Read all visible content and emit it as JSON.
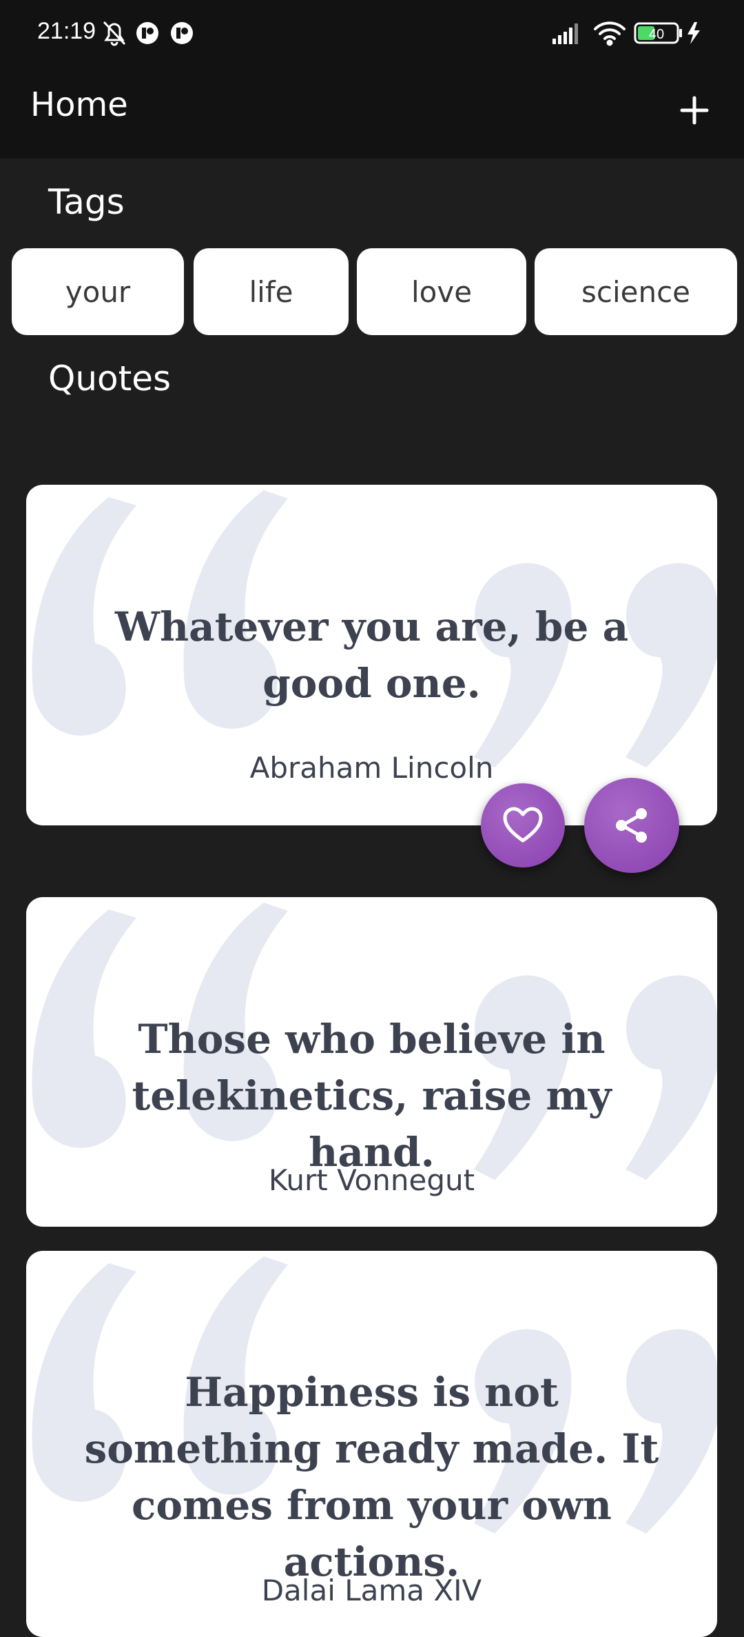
{
  "status": {
    "time": "21:19",
    "battery": "40"
  },
  "app_bar": {
    "title": "Home",
    "add_icon": "plus-icon"
  },
  "tags": {
    "title": "Tags",
    "items": [
      "your",
      "life",
      "love",
      "science"
    ]
  },
  "quotes": {
    "title": "Quotes",
    "items": [
      {
        "text": "Whatever you are, be a good one.",
        "author": "Abraham Lincoln"
      },
      {
        "text": "Those who believe in telekinetics, raise my hand.",
        "author": "Kurt Vonnegut"
      },
      {
        "text": "Happiness is not something ready made. It comes from your own actions.",
        "author": "Dalai Lama XIV"
      }
    ]
  },
  "actions": {
    "like_icon": "heart-icon",
    "share_icon": "share-icon"
  },
  "colors": {
    "background": "#1e1e1f",
    "app_bar": "#121212",
    "card": "#ffffff",
    "quote_text": "#3d4250",
    "quote_mark": "#e6e9f1",
    "accent": "#9b52bf"
  }
}
